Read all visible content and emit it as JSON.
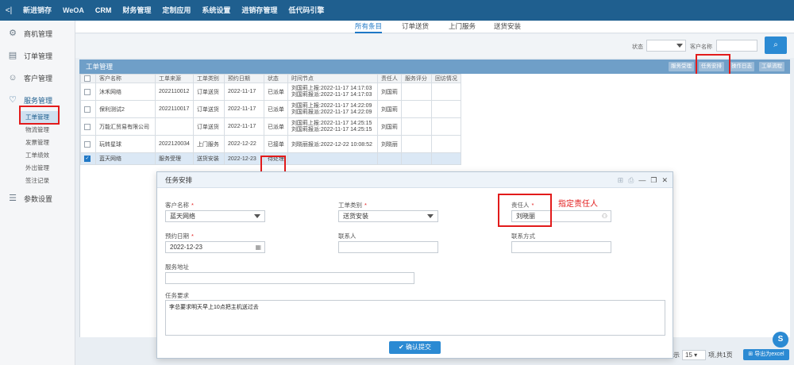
{
  "topnav": {
    "back": "<|",
    "items": [
      "新进销存",
      "WeOA",
      "CRM",
      "财务管理",
      "定制应用",
      "系统设置",
      "进销存管理",
      "低代码引擎"
    ]
  },
  "sidebar": {
    "groups": [
      {
        "label": "商机管理",
        "icon": "grid-icon"
      },
      {
        "label": "订单管理",
        "icon": "list-icon"
      },
      {
        "label": "客户管理",
        "icon": "user-icon"
      },
      {
        "label": "服务管理",
        "icon": "heart-icon"
      }
    ],
    "service_items": [
      "工单管理",
      "物流管理",
      "发票管理",
      "工单绩效",
      "外出管理",
      "签注记录"
    ],
    "settings_label": "参数设置"
  },
  "subtabs": [
    "所有条目",
    "订单送货",
    "上门服务",
    "送货安装"
  ],
  "filter": {
    "status_label": "状态",
    "customer_label": "客户名称",
    "search_icon": "search-icon"
  },
  "panel": {
    "title": "工单管理",
    "buttons": [
      "服务受理",
      "任务安排",
      "操作日志",
      "工单流程"
    ]
  },
  "table": {
    "headers": [
      "客户名称",
      "工单来源",
      "工单类别",
      "预约日期",
      "状态",
      "时间节点",
      "责任人",
      "服务评分",
      "回访情况"
    ],
    "rows": [
      {
        "customer": "沐禾网络",
        "source": "2022110012",
        "type": "订单送货",
        "date": "2022-11-17",
        "status": "已派单",
        "nodes": [
          "刘国莉上报:2022-11-17 14:17:03",
          "刘国莉报派:2022-11-17 14:17:03"
        ],
        "owner": "刘国莉",
        "checked": false
      },
      {
        "customer": "保利测试2",
        "source": "2022110017",
        "type": "订单送货",
        "date": "2022-11-17",
        "status": "已派单",
        "nodes": [
          "刘国莉上报:2022-11-17 14:22:09",
          "刘国莉报派:2022-11-17 14:22:09"
        ],
        "owner": "刘国莉",
        "checked": false
      },
      {
        "customer": "万能汇贸易有限公司",
        "source": "",
        "type": "订单送货",
        "date": "2022-11-17",
        "status": "已派单",
        "nodes": [
          "刘国莉上报:2022-11-17 14:25:15",
          "刘国莉报派:2022-11-17 14:25:15"
        ],
        "owner": "刘国莉",
        "checked": false
      },
      {
        "customer": "玩转星球",
        "source": "2022120034",
        "type": "上门服务",
        "date": "2022-12-22",
        "status": "已接单",
        "nodes": [
          "刘晓丽报派:2022-12-22 10:08:52"
        ],
        "owner": "刘晓丽",
        "checked": false
      },
      {
        "customer": "蓝天网络",
        "source": "服务受理",
        "type": "送货安装",
        "date": "2022-12-23",
        "status": "待处理",
        "nodes": [],
        "owner": "",
        "checked": true
      }
    ]
  },
  "pager": {
    "show_label": "显示",
    "page_size": "15",
    "summary": "项,共1页",
    "export_label": "导出为excel",
    "float_label": "S"
  },
  "modal": {
    "title": "任务安排",
    "customer_label": "客户名称",
    "customer_value": "蓝天网络",
    "ticket_type_label": "工单类别",
    "ticket_type_value": "送货安装",
    "owner_label": "责任人",
    "owner_value": "刘晓丽",
    "annotation": "指定责任人",
    "date_label": "预约日期",
    "date_value": "2022-12-23",
    "contact_label": "联系人",
    "contact_method_label": "联系方式",
    "address_label": "服务地址",
    "requirement_label": "任务要求",
    "requirement_value": "李总要求明天早上10点把主机送过去",
    "submit_label": "确认提交",
    "req_mark": "*"
  }
}
